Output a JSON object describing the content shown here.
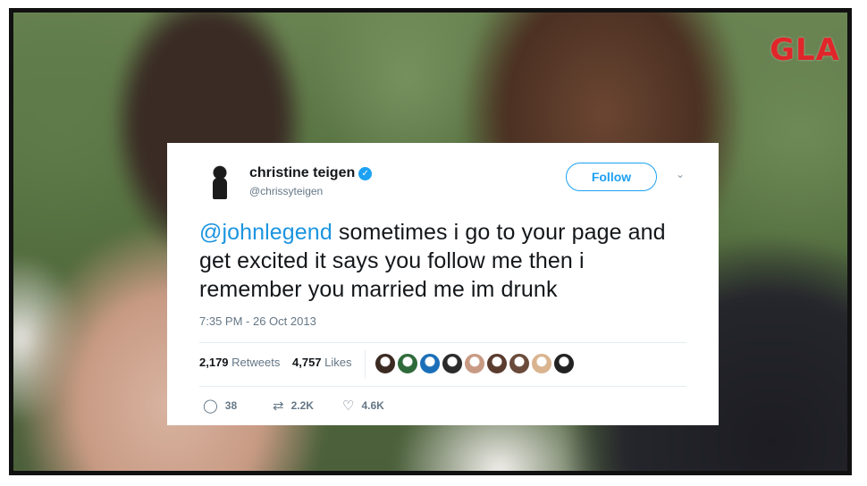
{
  "watermark": "GLA",
  "tweet": {
    "display_name": "christine teigen",
    "handle": "@chrissyteigen",
    "follow_label": "Follow",
    "mention": "@johnlegend",
    "text_rest": " sometimes i go to your page and get excited it says you follow me then i remember you married me im drunk",
    "timestamp": "7:35 PM - 26 Oct 2013",
    "retweets_count": "2,179",
    "retweets_label": " Retweets",
    "likes_count": "4,757",
    "likes_label": " Likes",
    "reply_count": "38",
    "retweet_count_short": "2.2K",
    "like_count_short": "4.6K",
    "icons": [
      "verified-badge-icon",
      "chevron-down-icon",
      "reply-icon",
      "retweet-icon",
      "heart-icon"
    ],
    "liker_avatar_colors": [
      "#3b2a22",
      "#2f6b3a",
      "#1b6fb8",
      "#2b2b2b",
      "#c89a84",
      "#5a3b2e",
      "#6a4a3a",
      "#d9b48f",
      "#222222"
    ]
  }
}
